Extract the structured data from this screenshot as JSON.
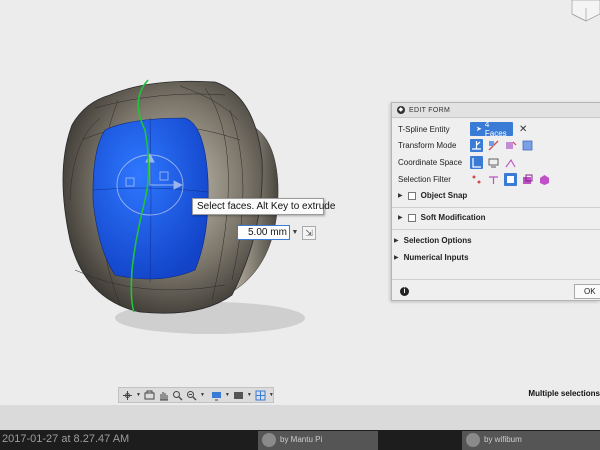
{
  "canvas": {
    "tooltip": "Select faces. Alt Key to extrude",
    "distance_value": "5.00 mm"
  },
  "edit_form": {
    "title": "EDIT FORM",
    "tspline_label": "T-Spline Entity",
    "faces_label": "4 Faces",
    "transform_label": "Transform Mode",
    "coordinate_label": "Coordinate Space",
    "filter_label": "Selection Filter",
    "object_snap": "Object Snap",
    "soft_mod": "Soft Modification",
    "selection_options": "Selection Options",
    "numerical_inputs": "Numerical Inputs",
    "ok_label": "OK"
  },
  "status_bar": {
    "message": "Multiple selections"
  },
  "bottom": {
    "timestamp": "2017-01-27 at 8.27.47 AM",
    "thumb1_by": "by Mantu Pi",
    "thumb2_by": "by wifibum"
  },
  "colors": {
    "accent": "#3a7bd5",
    "selected_face": "#1f5fe6",
    "model_body": "#7a7468",
    "edge_green": "#22c33a"
  }
}
